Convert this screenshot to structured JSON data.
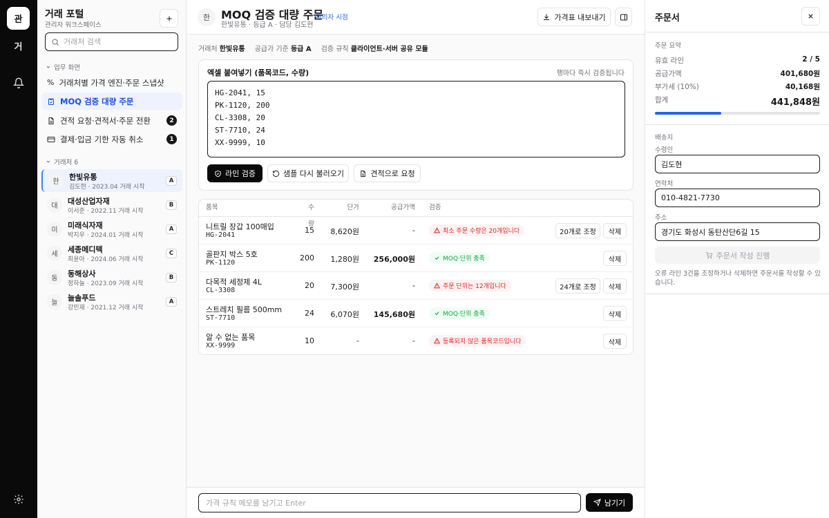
{
  "rail": {
    "home_label": "관",
    "second_label": "거"
  },
  "sidebar": {
    "title": "거래 포털",
    "subtitle": "관리자 워크스페이스",
    "search_placeholder": "거래처 검색",
    "section_work": "업무 화면",
    "nav": [
      {
        "label": "거래처별 가격 엔진·주문 스냅샷",
        "badge": ""
      },
      {
        "label": "MOQ 검증 대량 주문",
        "badge": ""
      },
      {
        "label": "견적 요청·견적서·주문 전환",
        "badge": "2"
      },
      {
        "label": "결제·입금 기한 자동 취소",
        "badge": "1"
      }
    ],
    "section_clients": "거래처 6",
    "clients": [
      {
        "avatar": "한",
        "name": "한빛유통",
        "meta": "김도현 · 2023.04 거래 시작",
        "grade": "A"
      },
      {
        "avatar": "대",
        "name": "대성산업자재",
        "meta": "이서준 · 2022.11 거래 시작",
        "grade": "B"
      },
      {
        "avatar": "미",
        "name": "미래식자재",
        "meta": "박지우 · 2024.01 거래 시작",
        "grade": "A"
      },
      {
        "avatar": "세",
        "name": "세종메디텍",
        "meta": "최윤아 · 2024.06 거래 시작",
        "grade": "C"
      },
      {
        "avatar": "동",
        "name": "동해상사",
        "meta": "정하늘 · 2023.09 거래 시작",
        "grade": "B"
      },
      {
        "avatar": "늘",
        "name": "늘솔푸드",
        "meta": "강민재 · 2021.12 거래 시작",
        "grade": "A"
      }
    ]
  },
  "header": {
    "avatar": "한",
    "title": "MOQ 검증 대량 주문",
    "badge": "관리자 시점",
    "subtitle": "한빛유통 · 등급 A · 담당 김도현",
    "export_label": "가격표 내보내기"
  },
  "meta": {
    "client_label": "거래처",
    "client_value": "한빛유통",
    "tier_label": "공급가 기준",
    "tier_value": "등급 A",
    "rule_label": "검증 규칙",
    "rule_value": "클라이언트·서버 공유 모듈"
  },
  "paste": {
    "title": "엑셀 붙여넣기 (품목코드, 수량)",
    "hint": "행마다 즉시 검증됩니다",
    "lines": [
      "HG-2041, 15",
      "PK-1120, 200",
      "CL-3308, 20",
      "ST-7710, 24",
      "XX-9999, 10"
    ],
    "validate_label": "라인 검증",
    "reload_label": "샘플 다시 불러오기",
    "quote_label": "견적으로 요청"
  },
  "table": {
    "headers": {
      "item": "품목",
      "qty": "수량",
      "price": "단가",
      "amount": "공급가액",
      "check": "검증"
    },
    "rows": [
      {
        "name": "니트릴 장갑 100매입",
        "code": "HG-2041",
        "qty": "15",
        "price": "8,620원",
        "amount": "-",
        "status": "err",
        "message": "최소 주문 수량은 20개입니다",
        "fix": "20개로 조정",
        "delete": "삭제"
      },
      {
        "name": "골판지 박스 5호",
        "code": "PK-1120",
        "qty": "200",
        "price": "1,280원",
        "amount": "256,000원",
        "status": "ok",
        "message": "MOQ·단위 충족",
        "fix": "",
        "delete": "삭제"
      },
      {
        "name": "다목적 세정제 4L",
        "code": "CL-3308",
        "qty": "20",
        "price": "7,300원",
        "amount": "-",
        "status": "err",
        "message": "주문 단위는 12개입니다",
        "fix": "24개로 조정",
        "delete": "삭제"
      },
      {
        "name": "스트레치 필름 500mm",
        "code": "ST-7710",
        "qty": "24",
        "price": "6,070원",
        "amount": "145,680원",
        "status": "ok",
        "message": "MOQ·단위 충족",
        "fix": "",
        "delete": "삭제"
      },
      {
        "name": "알 수 없는 품목",
        "code": "XX-9999",
        "qty": "10",
        "price": "-",
        "amount": "-",
        "status": "err",
        "message": "등록되지 않은 품목코드입니다",
        "fix": "",
        "delete": "삭제"
      }
    ]
  },
  "footer": {
    "memo_placeholder": "가격 규칙 메모를 남기고 Enter",
    "send_label": "남기기"
  },
  "order": {
    "title": "주문서",
    "summary_label": "주문 요약",
    "valid_label": "유효 라인",
    "valid_value": "2 / 5",
    "progress": 0.4,
    "supply_label": "공급가액",
    "supply_value": "401,680원",
    "vat_label": "부가세 (10%)",
    "vat_value": "40,168원",
    "total_label": "합계",
    "total_value": "441,848원",
    "ship_label": "배송지",
    "recipient_label": "수령인",
    "recipient_value": "김도현",
    "phone_label": "연락처",
    "phone_value": "010-4821-7730",
    "address_label": "주소",
    "address_value": "경기도 화성시 동탄산단6길 15",
    "submit_label": "주문서 작성 진행",
    "note": "오류 라인 3건을 조정하거나 삭제하면 주문서를 작성할 수 있습니다."
  },
  "colors": {
    "accent": "#2563eb",
    "error": "#dc2626",
    "ok": "#16a34a",
    "dark": "#0a0a0a"
  }
}
